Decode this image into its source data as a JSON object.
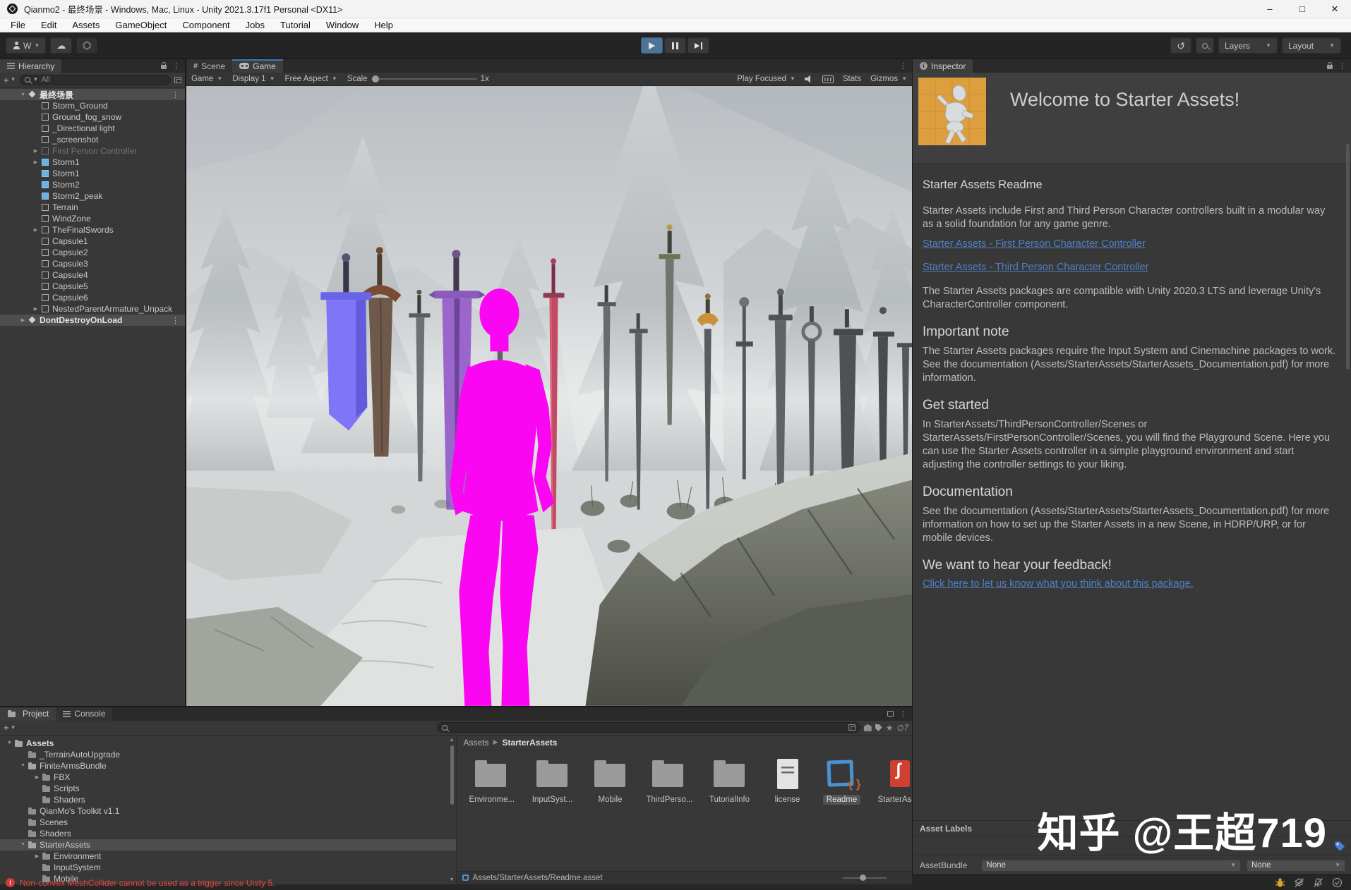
{
  "window": {
    "title": "Qianmo2 - 最终场景 - Windows, Mac, Linux - Unity 2021.3.17f1 Personal <DX11>"
  },
  "menu": {
    "items": [
      "File",
      "Edit",
      "Assets",
      "GameObject",
      "Component",
      "Jobs",
      "Tutorial",
      "Window",
      "Help"
    ]
  },
  "toolbar": {
    "account": "W",
    "layers": "Layers",
    "layout": "Layout"
  },
  "hierarchy": {
    "tab": "Hierarchy",
    "search": "All",
    "items": [
      {
        "label": "最终场景",
        "icon": "scene",
        "depth": 0,
        "arrow": "down",
        "state": "selected",
        "kebab": true
      },
      {
        "label": "Storm_Ground",
        "icon": "cube",
        "depth": 1
      },
      {
        "label": "Ground_fog_snow",
        "icon": "cube",
        "depth": 1
      },
      {
        "label": "_Directional light",
        "icon": "cube",
        "depth": 1
      },
      {
        "label": "_screenshot",
        "icon": "cube",
        "depth": 1
      },
      {
        "label": "First Person Controller",
        "icon": "cube",
        "depth": 1,
        "arrow": "right",
        "state": "disabled"
      },
      {
        "label": "Storm1",
        "icon": "prefab",
        "depth": 1,
        "arrow": "right"
      },
      {
        "label": "Storm1",
        "icon": "prefab",
        "depth": 1
      },
      {
        "label": "Storm2",
        "icon": "prefab",
        "depth": 1
      },
      {
        "label": "Storm2_peak",
        "icon": "prefab",
        "depth": 1
      },
      {
        "label": "Terrain",
        "icon": "cube",
        "depth": 1
      },
      {
        "label": "WindZone",
        "icon": "cube",
        "depth": 1
      },
      {
        "label": "TheFinalSwords",
        "icon": "cube",
        "depth": 1,
        "arrow": "right"
      },
      {
        "label": "Capsule1",
        "icon": "cube",
        "depth": 1
      },
      {
        "label": "Capsule2",
        "icon": "cube",
        "depth": 1
      },
      {
        "label": "Capsule3",
        "icon": "cube",
        "depth": 1
      },
      {
        "label": "Capsule4",
        "icon": "cube",
        "depth": 1
      },
      {
        "label": "Capsule5",
        "icon": "cube",
        "depth": 1
      },
      {
        "label": "Capsule6",
        "icon": "cube",
        "depth": 1
      },
      {
        "label": "NestedParentArmature_Unpack",
        "icon": "cube",
        "depth": 1,
        "arrow": "right"
      },
      {
        "label": "DontDestroyOnLoad",
        "icon": "scene",
        "depth": 0,
        "arrow": "right",
        "state": "selected",
        "kebab": true
      }
    ]
  },
  "game": {
    "tabs": {
      "scene": "Scene",
      "game": "Game"
    },
    "controls": {
      "display_target": "Game",
      "display": "Display 1",
      "aspect": "Free Aspect",
      "scale_label": "Scale",
      "scale_value": "1x",
      "focus": "Play Focused",
      "stats": "Stats",
      "gizmos": "Gizmos"
    }
  },
  "inspector": {
    "tab": "Inspector",
    "welcome": "Welcome to Starter Assets!",
    "sections": [
      {
        "type": "title",
        "inter": "false",
        "text": "Starter Assets Readme"
      },
      {
        "type": "p",
        "inter": "false",
        "text": "Starter Assets include First and Third Person Character controllers built in a modular way as a solid foundation for any game genre."
      },
      {
        "type": "link",
        "inter": "true",
        "text": "Starter Assets - First Person Character Controller"
      },
      {
        "type": "link",
        "inter": "true",
        "text": "Starter Assets - Third Person Character Controller"
      },
      {
        "type": "p",
        "inter": "false",
        "text": "The Starter Assets packages are compatible with Unity 2020.3 LTS and leverage Unity's CharacterController component."
      },
      {
        "type": "h",
        "inter": "false",
        "text": "Important note"
      },
      {
        "type": "p",
        "inter": "false",
        "text": "The Starter Assets packages require the Input System and Cinemachine packages to work. See the documentation (Assets/StarterAssets/StarterAssets_Documentation.pdf) for more information."
      },
      {
        "type": "h",
        "inter": "false",
        "text": "Get started"
      },
      {
        "type": "p",
        "inter": "false",
        "text": "In StarterAssets/ThirdPersonController/Scenes or StarterAssets/FirstPersonController/Scenes, you will find the Playground Scene. Here you can use the Starter Assets controller in a simple playground environment and start adjusting the controller settings to your liking."
      },
      {
        "type": "h",
        "inter": "false",
        "text": "Documentation"
      },
      {
        "type": "p",
        "inter": "false",
        "text": "See the documentation (Assets/StarterAssets/StarterAssets_Documentation.pdf) for more information on how to set up the Starter Assets in a new Scene, in HDRP/URP, or for mobile devices."
      },
      {
        "type": "h",
        "inter": "false",
        "text": "We want to hear your feedback!"
      },
      {
        "type": "link",
        "inter": "true",
        "text": "Click here to let us know what you think about this package."
      }
    ],
    "asset_labels": "Asset Labels",
    "assetbundle": {
      "label": "AssetBundle",
      "bundle": "None",
      "variant": "None"
    }
  },
  "project": {
    "tabs": {
      "project": "Project",
      "console": "Console"
    },
    "tree": [
      {
        "label": "Assets",
        "depth": 0,
        "arrow": "down",
        "icon": "folder-open",
        "state": "root"
      },
      {
        "label": "_TerrainAutoUpgrade",
        "depth": 1,
        "icon": "folder"
      },
      {
        "label": "FiniteArmsBundle",
        "depth": 1,
        "arrow": "down",
        "icon": "folder-open"
      },
      {
        "label": "FBX",
        "depth": 2,
        "arrow": "right",
        "icon": "folder"
      },
      {
        "label": "Scripts",
        "depth": 2,
        "icon": "folder"
      },
      {
        "label": "Shaders",
        "depth": 2,
        "icon": "folder"
      },
      {
        "label": "QianMo's Toolkit v1.1",
        "depth": 1,
        "icon": "folder"
      },
      {
        "label": "Scenes",
        "depth": 1,
        "icon": "folder"
      },
      {
        "label": "Shaders",
        "depth": 1,
        "icon": "folder"
      },
      {
        "label": "StarterAssets",
        "depth": 1,
        "arrow": "down",
        "icon": "folder-open",
        "state": "selected"
      },
      {
        "label": "Environment",
        "depth": 2,
        "arrow": "right",
        "icon": "folder"
      },
      {
        "label": "InputSystem",
        "depth": 2,
        "icon": "folder"
      },
      {
        "label": "Mobile",
        "depth": 2,
        "icon": "folder"
      }
    ],
    "breadcrumb": {
      "root": "Assets",
      "current": "StarterAssets"
    },
    "grid": [
      {
        "label": "Environme...",
        "icon": "folder"
      },
      {
        "label": "InputSyst...",
        "icon": "folder"
      },
      {
        "label": "Mobile",
        "icon": "folder"
      },
      {
        "label": "ThirdPerso...",
        "icon": "folder"
      },
      {
        "label": "TutorialInfo",
        "icon": "folder"
      },
      {
        "label": "license",
        "icon": "doc"
      },
      {
        "label": "Readme",
        "icon": "scriptobj",
        "state": "selected"
      },
      {
        "label": "StarterAss...",
        "icon": "pdf"
      }
    ],
    "selection_path": "Assets/StarterAssets/Readme.asset",
    "hidden_count": "7"
  },
  "status": {
    "error": "Non-convex MeshCollider cannot be used as a trigger since Unity 5."
  },
  "watermark": "知乎 @王超719"
}
